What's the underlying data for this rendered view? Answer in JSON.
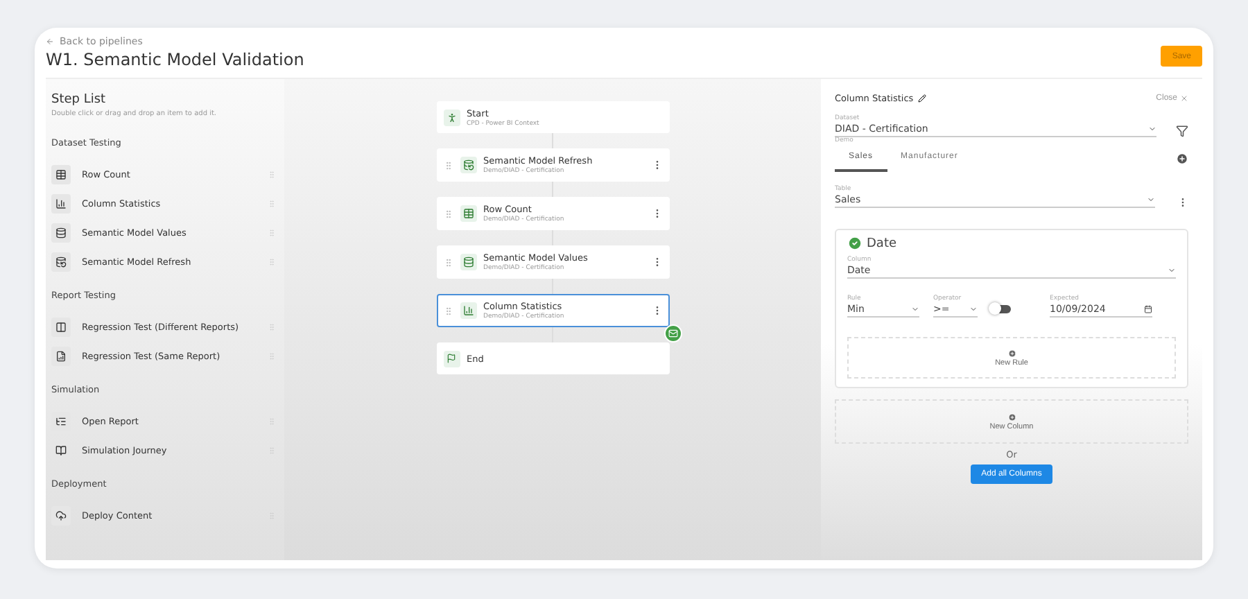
{
  "header": {
    "back_link": "Back to pipelines",
    "title": "W1. Semantic Model Validation",
    "save_button": "Save"
  },
  "step_list": {
    "title": "Step List",
    "hint": "Double click or drag and drop an item to add it.",
    "groups": [
      {
        "title": "Dataset Testing",
        "items": [
          {
            "label": "Row Count"
          },
          {
            "label": "Column Statistics"
          },
          {
            "label": "Semantic Model Values"
          },
          {
            "label": "Semantic Model Refresh"
          }
        ]
      },
      {
        "title": "Report Testing",
        "items": [
          {
            "label": "Regression Test (Different Reports)"
          },
          {
            "label": "Regression Test (Same Report)"
          }
        ]
      },
      {
        "title": "Simulation",
        "items": [
          {
            "label": "Open Report"
          },
          {
            "label": "Simulation Journey"
          }
        ]
      },
      {
        "title": "Deployment",
        "items": [
          {
            "label": "Deploy Content"
          }
        ]
      }
    ]
  },
  "pipeline": {
    "nodes": [
      {
        "kind": "start",
        "title": "Start",
        "subtitle": "CPD - Power BI Context",
        "selected": false
      },
      {
        "kind": "step",
        "title": "Semantic Model Refresh",
        "subtitle": "Demo/DIAD - Certification",
        "selected": false
      },
      {
        "kind": "step",
        "title": "Row Count",
        "subtitle": "Demo/DIAD - Certification",
        "selected": false
      },
      {
        "kind": "step",
        "title": "Semantic Model Values",
        "subtitle": "Demo/DIAD - Certification",
        "selected": false
      },
      {
        "kind": "step",
        "title": "Column Statistics",
        "subtitle": "Demo/DIAD - Certification",
        "selected": true
      },
      {
        "kind": "end",
        "title": "End",
        "selected": false
      }
    ]
  },
  "panel": {
    "title": "Column Statistics",
    "close": "Close",
    "dataset": {
      "label": "Dataset",
      "value": "DIAD - Certification",
      "helper": "Demo"
    },
    "tabs": [
      {
        "label": "Sales",
        "selected": true
      },
      {
        "label": "Manufacturer",
        "selected": false
      }
    ],
    "table": {
      "label": "Table",
      "value": "Sales"
    },
    "column_card": {
      "title": "Date",
      "column": {
        "label": "Column",
        "value": "Date"
      },
      "rule": {
        "label": "Rule",
        "value": "Min"
      },
      "operator": {
        "label": "Operator",
        "value": ">="
      },
      "toggle": {
        "on": false
      },
      "expected": {
        "label": "Expected",
        "value": "10/09/2024"
      },
      "new_rule": "New Rule"
    },
    "new_column": "New Column",
    "or": "Or",
    "add_all_button": "Add all Columns"
  }
}
